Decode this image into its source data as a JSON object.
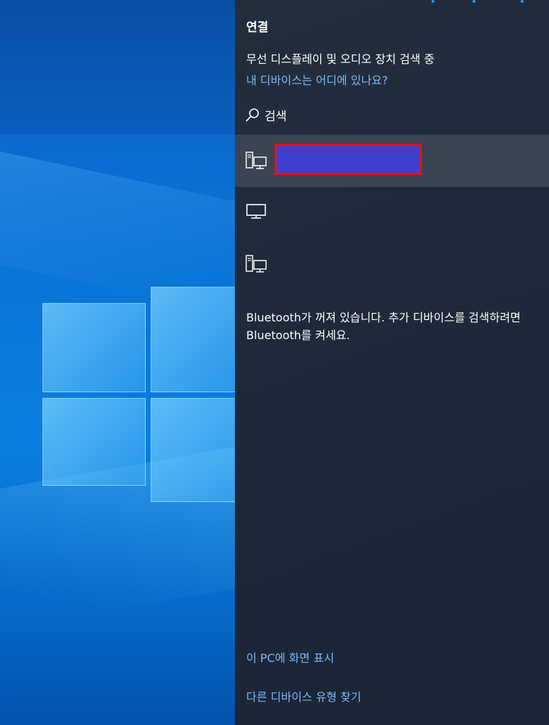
{
  "panel": {
    "title": "연결",
    "status": "무선 디스플레이 및 오디오 장치 검색 중",
    "help_link": "내 디바이스는 어디에 있나요?",
    "search_label": "검색",
    "devices": [
      {
        "icon": "computer-icon",
        "name": "",
        "selected": true
      },
      {
        "icon": "monitor-icon",
        "name": "",
        "selected": false
      },
      {
        "icon": "computer-icon",
        "name": "",
        "selected": false
      }
    ],
    "bluetooth_message": "Bluetooth가 꺼져 있습니다. 추가 디바이스를 검색하려면 Bluetooth를 켜세요.",
    "project_link": "이 PC에 화면 표시",
    "other_devices_link": "다른 디바이스 유형 찾기"
  },
  "colors": {
    "panel_bg": "#1c2738",
    "selected_bg": "#3a4452",
    "link": "#7fb9f2",
    "redaction_fill": "#4040d0",
    "redaction_border": "#e0141e"
  }
}
